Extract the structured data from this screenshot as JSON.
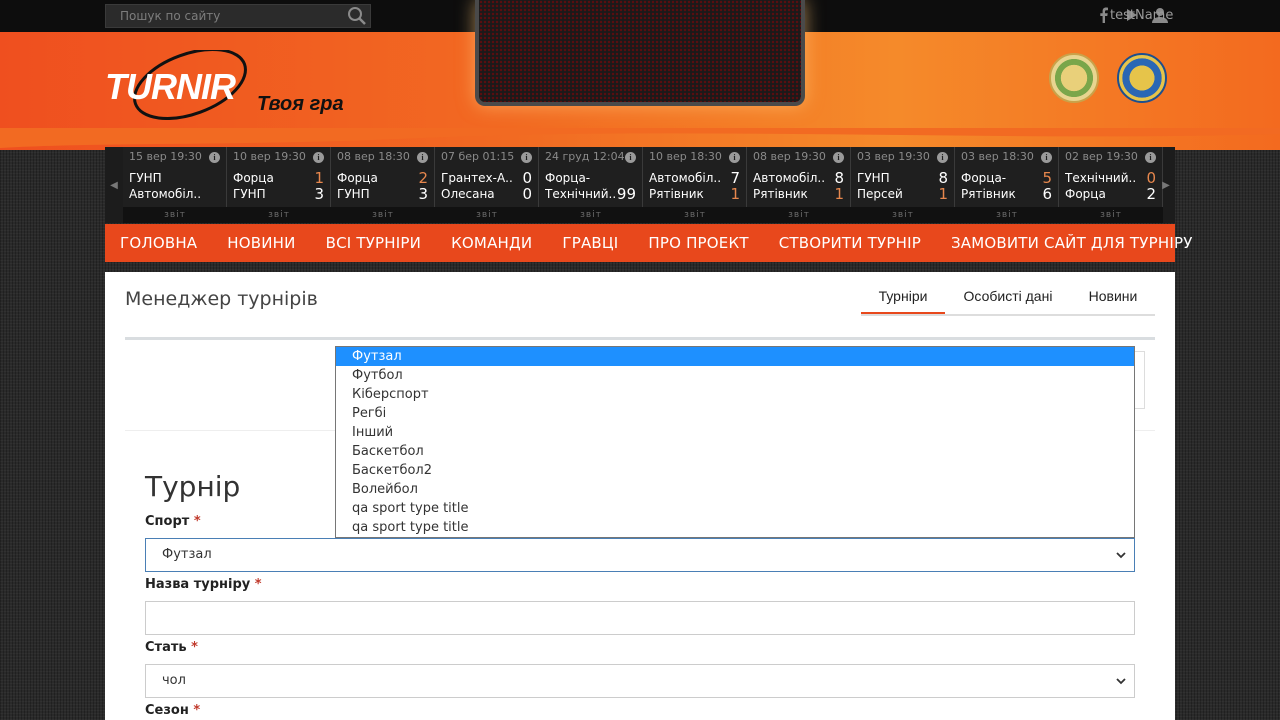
{
  "topbar": {
    "search_placeholder": "Пошук по сайту",
    "user_name": "testName"
  },
  "brand": {
    "logo_text": "TURNIR",
    "slogan": "Твоя гра"
  },
  "matches": [
    {
      "date": "15 вер 19:30",
      "team1": "ГУНП",
      "score1": "",
      "team2": "Автомобіл..",
      "score2": ""
    },
    {
      "date": "10 вер 19:30",
      "team1": "Форца",
      "score1": "1",
      "team2": "ГУНП",
      "score2": "3"
    },
    {
      "date": "08 вер 18:30",
      "team1": "Форца",
      "score1": "2",
      "team2": "ГУНП",
      "score2": "3"
    },
    {
      "date": "07 бер 01:15",
      "team1": "Грантех-А..",
      "score1": "0",
      "team2": "Олесана",
      "score2": "0"
    },
    {
      "date": "24 груд 12:04",
      "team1": "Форца-",
      "score1": "",
      "team2": "Технічний..",
      "score2": "99"
    },
    {
      "date": "10 вер 18:30",
      "team1": "Автомобіл..",
      "score1": "7",
      "team2": "Рятівник",
      "score2": "1"
    },
    {
      "date": "08 вер 19:30",
      "team1": "Автомобіл..",
      "score1": "8",
      "team2": "Рятівник",
      "score2": "1"
    },
    {
      "date": "03 вер 19:30",
      "team1": "ГУНП",
      "score1": "8",
      "team2": "Персей",
      "score2": "1"
    },
    {
      "date": "03 вер 18:30",
      "team1": "Форца-",
      "score1": "5",
      "team2": "Рятівник",
      "score2": "6"
    },
    {
      "date": "02 вер 19:30",
      "team1": "Технічний..",
      "score1": "0",
      "team2": "Форца",
      "score2": "2"
    }
  ],
  "match_report_label": "звіт",
  "nav": [
    "ГОЛОВНА",
    "НОВИНИ",
    "ВСІ ТУРНІРИ",
    "КОМАНДИ",
    "ГРАВЦІ",
    "ПРО ПРОЕКТ",
    "СТВОРИТИ ТУРНІР",
    "ЗАМОВИТИ САЙТ ДЛЯ ТУРНІРУ"
  ],
  "main": {
    "page_title": "Менеджер турнірів",
    "tabs": [
      "Турніри",
      "Особисті дані",
      "Новини"
    ],
    "form_title": "Турнір",
    "sport_label": "Спорт",
    "sport_value": "Футзал",
    "name_label": "Назва турніру",
    "name_value": "",
    "gender_label": "Стать",
    "gender_value": "чол",
    "season_label": "Сезон",
    "required_mark": "*"
  },
  "sport_options": [
    "Футзал",
    "Футбол",
    "Кіберспорт",
    "Регбі",
    "Інший",
    "Баскетбол",
    "Баскетбол2",
    "Волейбол",
    "qa sport type title",
    "qa sport type title"
  ],
  "colors": {
    "accent": "#e8481c",
    "selected_option": "#1e90ff",
    "loss_score": "#e7874d"
  }
}
